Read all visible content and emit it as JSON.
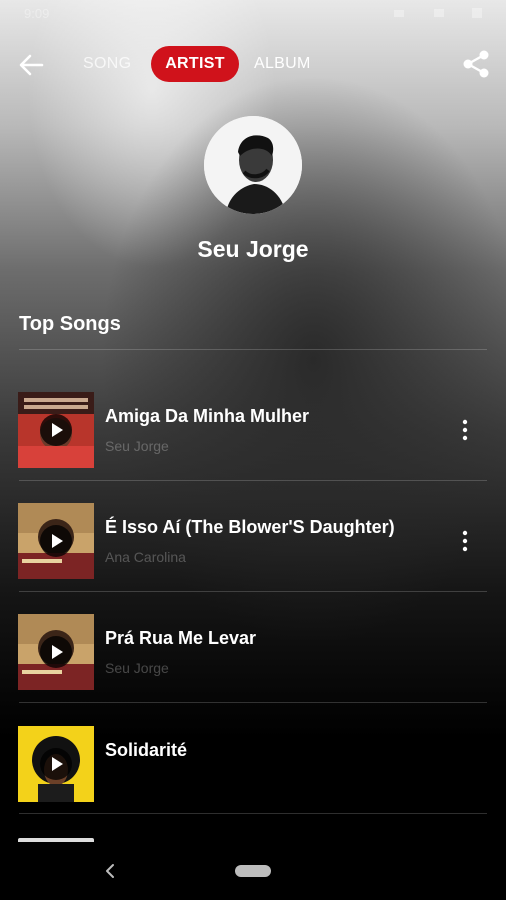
{
  "status_bar": {
    "time": "9:09"
  },
  "tabs": [
    {
      "label": "SONG",
      "active": false
    },
    {
      "label": "ARTIST",
      "active": true
    },
    {
      "label": "ALBUM",
      "active": false
    }
  ],
  "artist": {
    "name": "Seu Jorge"
  },
  "section": {
    "title": "Top Songs"
  },
  "songs": [
    {
      "title": "Amiga Da Minha Mulher",
      "subtitle": "Seu Jorge",
      "has_menu": true
    },
    {
      "title": "É Isso Aí (The Blower'S Daughter)",
      "subtitle": "Ana Carolina",
      "has_menu": true
    },
    {
      "title": "Prá Rua Me Levar",
      "subtitle": "Seu Jorge",
      "has_menu": false
    },
    {
      "title": "Solidarité",
      "subtitle": "",
      "has_menu": false
    }
  ],
  "colors": {
    "accent": "#d0121b",
    "text": "#ffffff"
  },
  "icons": [
    "back-arrow-icon",
    "share-icon",
    "play-icon",
    "more-vert-icon",
    "nav-back-icon"
  ]
}
